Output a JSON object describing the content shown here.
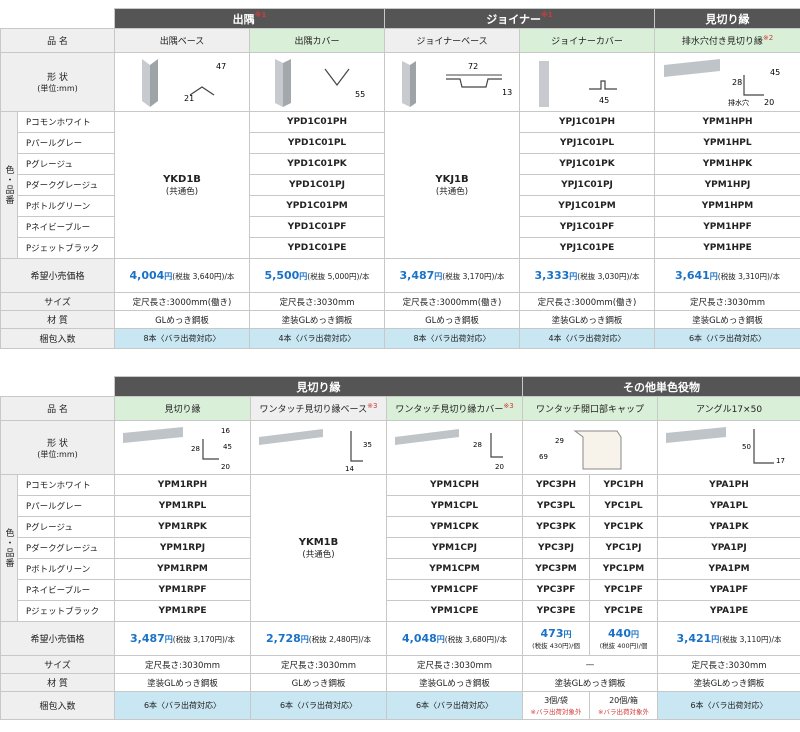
{
  "colors": [
    "Pコモンホワイト",
    "Pパールグレー",
    "Pグレージュ",
    "Pダークグレージュ",
    "Pボトルグリーン",
    "Pネイビーブルー",
    "Pジェットブラック"
  ],
  "labels": {
    "name": "品 名",
    "shape": "形 状",
    "unit": "(単位:mm)",
    "color_label": "色・品番",
    "price": "希望小売価格",
    "size": "サイズ",
    "material": "材 質",
    "pack": "梱包入数"
  },
  "table1": {
    "groups": [
      {
        "title": "出隅",
        "note": "※1"
      },
      {
        "title": "ジョイナー",
        "note": "※1"
      },
      {
        "title": "見切り縁",
        "note": ""
      }
    ],
    "products": [
      {
        "name": "出隅ベース",
        "note": "",
        "dims": [
          "47",
          "21"
        ],
        "common_code": "YKD1B",
        "common_label": "(共通色)",
        "price": "4,004",
        "price_unit": "円",
        "tax": "(税抜 3,640円)/本",
        "size": "定尺長さ:3000mm(働き)",
        "material": "GLめっき鋼板",
        "pack": "8本〈バラ出荷対応〉"
      },
      {
        "name": "出隅カバー",
        "note": "",
        "dims": [
          "55"
        ],
        "codes": [
          "YPD1C01PH",
          "YPD1C01PL",
          "YPD1C01PK",
          "YPD1C01PJ",
          "YPD1C01PM",
          "YPD1C01PF",
          "YPD1C01PE"
        ],
        "price": "5,500",
        "price_unit": "円",
        "tax": "(税抜 5,000円)/本",
        "size": "定尺長さ:3030mm",
        "material": "塗装GLめっき鋼板",
        "pack": "4本〈バラ出荷対応〉"
      },
      {
        "name": "ジョイナーベース",
        "note": "",
        "dims": [
          "72",
          "13"
        ],
        "common_code": "YKJ1B",
        "common_label": "(共通色)",
        "price": "3,487",
        "price_unit": "円",
        "tax": "(税抜 3,170円)/本",
        "size": "定尺長さ:3000mm(働き)",
        "material": "GLめっき鋼板",
        "pack": "8本〈バラ出荷対応〉"
      },
      {
        "name": "ジョイナーカバー",
        "note": "",
        "dims": [
          "45"
        ],
        "codes": [
          "YPJ1C01PH",
          "YPJ1C01PL",
          "YPJ1C01PK",
          "YPJ1C01PJ",
          "YPJ1C01PM",
          "YPJ1C01PF",
          "YPJ1C01PE"
        ],
        "price": "3,333",
        "price_unit": "円",
        "tax": "(税抜 3,030円)/本",
        "size": "定尺長さ:3000mm(働き)",
        "material": "塗装GLめっき鋼板",
        "pack": "4本〈バラ出荷対応〉"
      },
      {
        "name": "排水穴付き見切り縁",
        "note": "※2",
        "dims": [
          "45",
          "28",
          "20"
        ],
        "dim_label": "排水穴",
        "codes": [
          "YPM1HPH",
          "YPM1HPL",
          "YPM1HPK",
          "YPM1HPJ",
          "YPM1HPM",
          "YPM1HPF",
          "YPM1HPE"
        ],
        "price": "3,641",
        "price_unit": "円",
        "tax": "(税抜 3,310円)/本",
        "size": "定尺長さ:3030mm",
        "material": "塗装GLめっき鋼板",
        "pack": "6本〈バラ出荷対応〉"
      }
    ]
  },
  "table2": {
    "groups": [
      {
        "title": "見切り縁",
        "note": ""
      },
      {
        "title": "その他単色役物",
        "note": ""
      }
    ],
    "products": [
      {
        "name": "見切り縁",
        "note": "",
        "dims": [
          "16",
          "28",
          "45",
          "20"
        ],
        "codes": [
          "YPM1RPH",
          "YPM1RPL",
          "YPM1RPK",
          "YPM1RPJ",
          "YPM1RPM",
          "YPM1RPF",
          "YPM1RPE"
        ],
        "price": "3,487",
        "price_unit": "円",
        "tax": "(税抜 3,170円)/本",
        "size": "定尺長さ:3030mm",
        "material": "塗装GLめっき鋼板",
        "pack": "6本〈バラ出荷対応〉"
      },
      {
        "name": "ワンタッチ見切り縁ベース",
        "note": "※3",
        "dims": [
          "35",
          "14"
        ],
        "common_code": "YKM1B",
        "common_label": "(共通色)",
        "price": "2,728",
        "price_unit": "円",
        "tax": "(税抜 2,480円)/本",
        "size": "定尺長さ:3030mm",
        "material": "GLめっき鋼板",
        "pack": "6本〈バラ出荷対応〉"
      },
      {
        "name": "ワンタッチ見切り縁カバー",
        "note": "※3",
        "dims": [
          "28",
          "20"
        ],
        "codes": [
          "YPM1CPH",
          "YPM1CPL",
          "YPM1CPK",
          "YPM1CPJ",
          "YPM1CPM",
          "YPM1CPF",
          "YPM1CPE"
        ],
        "price": "4,048",
        "price_unit": "円",
        "tax": "(税抜 3,680円)/本",
        "size": "定尺長さ:3030mm",
        "material": "塗装GLめっき鋼板",
        "pack": "6本〈バラ出荷対応〉"
      },
      {
        "name": "ワンタッチ開口部キャップ",
        "note": "",
        "dims": [
          "29",
          "69"
        ],
        "codes_a": [
          "YPC3PH",
          "YPC3PL",
          "YPC3PK",
          "YPC3PJ",
          "YPC3PM",
          "YPC3PF",
          "YPC3PE"
        ],
        "codes_b": [
          "YPC1PH",
          "YPC1PL",
          "YPC1PK",
          "YPC1PJ",
          "YPC1PM",
          "YPC1PF",
          "YPC1PE"
        ],
        "price_a": "473",
        "tax_a": "(税抜 430円)/個",
        "price_b": "440",
        "tax_b": "(税抜 400円)/個",
        "price_unit": "円",
        "size": "—",
        "material": "塗装GLめっき鋼板",
        "pack_a": "3個/袋",
        "pack_b": "20個/箱",
        "pack_note": "※バラ出荷対象外"
      },
      {
        "name": "アングル17×50",
        "note": "",
        "dims": [
          "50",
          "17"
        ],
        "codes": [
          "YPA1PH",
          "YPA1PL",
          "YPA1PK",
          "YPA1PJ",
          "YPA1PM",
          "YPA1PF",
          "YPA1PE"
        ],
        "price": "3,421",
        "price_unit": "円",
        "tax": "(税抜 3,110円)/本",
        "size": "定尺長さ:3030mm",
        "material": "塗装GLめっき鋼板",
        "pack": "6本〈バラ出荷対応〉"
      }
    ]
  }
}
